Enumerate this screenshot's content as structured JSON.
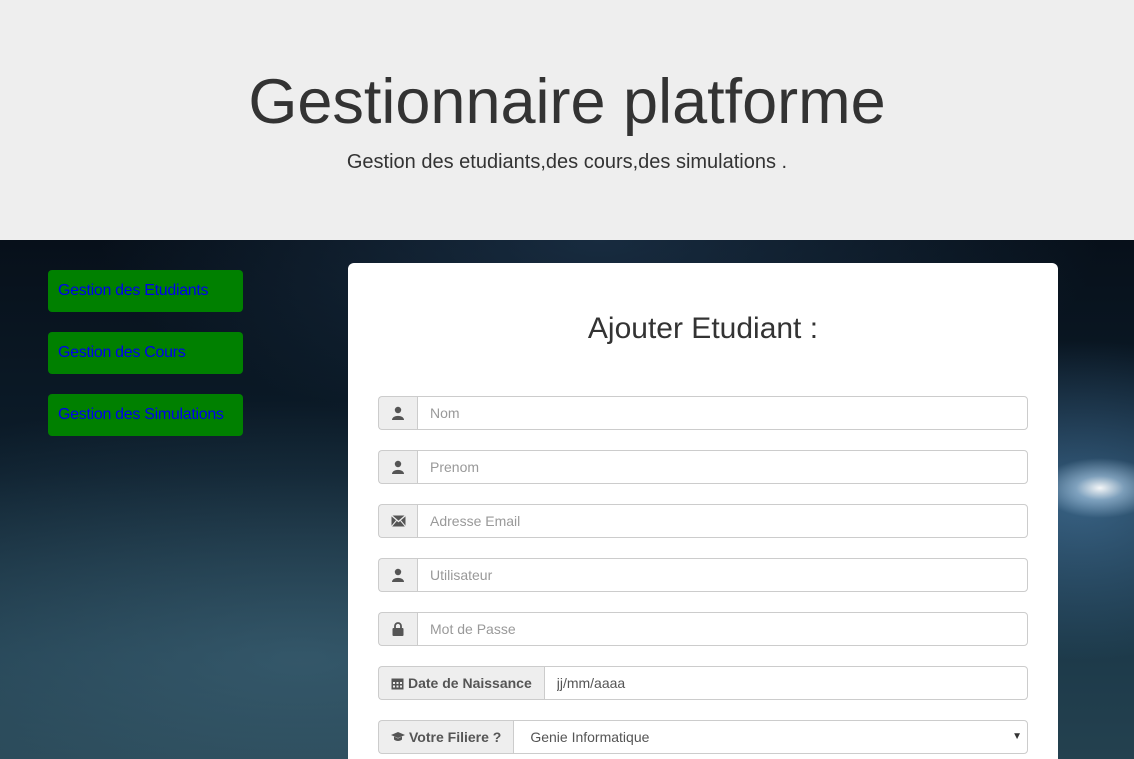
{
  "header": {
    "title": "Gestionnaire platforme",
    "subtitle": "Gestion des etudiants,des cours,des simulations ."
  },
  "sidebar": {
    "items": [
      {
        "label": "Gestion des Etudiants"
      },
      {
        "label": "Gestion des Cours"
      },
      {
        "label": "Gestion des Simulations"
      }
    ]
  },
  "form": {
    "title": "Ajouter Etudiant :",
    "nom": {
      "placeholder": "Nom",
      "icon": "user-icon"
    },
    "prenom": {
      "placeholder": "Prenom",
      "icon": "user-icon"
    },
    "email": {
      "placeholder": "Adresse Email",
      "icon": "envelope-icon"
    },
    "utilisateur": {
      "placeholder": "Utilisateur",
      "icon": "user-icon"
    },
    "password": {
      "placeholder": "Mot de Passe",
      "icon": "lock-icon"
    },
    "birthdate": {
      "label": "Date de Naissance",
      "value": "jj/mm/aaaa",
      "icon": "calendar-icon"
    },
    "filiere": {
      "label": "Votre Filiere ?",
      "selected": "Genie Informatique",
      "icon": "graduation-cap-icon"
    }
  },
  "colors": {
    "jumbotron_bg": "#eeeeee",
    "sidebar_button_bg": "#008000",
    "sidebar_button_text": "#0000ee"
  }
}
